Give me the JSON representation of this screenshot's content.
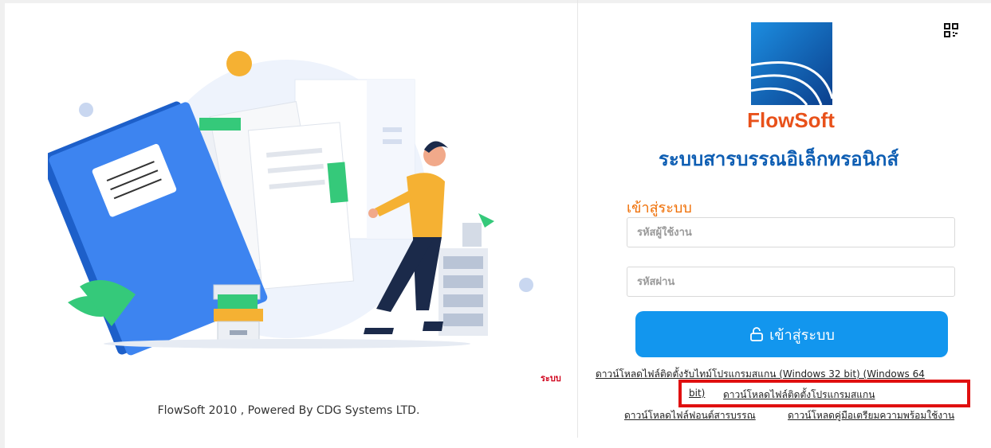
{
  "footer": {
    "copyright": "FlowSoft 2010 , Powered By CDG Systems LTD."
  },
  "logo": {
    "brand": "FlowSoft"
  },
  "header": {
    "system_title": "ระบบสารบรรณอิเล็กทรอนิกส์"
  },
  "login": {
    "heading": "เข้าสู่ระบบ",
    "username_placeholder": "รหัสผู้ใช้งาน",
    "password_placeholder": "รหัสผ่าน",
    "button_label": "เข้าสู่ระบบ"
  },
  "notice": {
    "red_word": "ระบบ"
  },
  "downloads": {
    "scanner_32_64": "ดาวน์โหลดไฟล์ติดตั้งรับไทม์โปรแกรมสแกน (Windows 32 bit) (Windows 64",
    "scanner_32_64_cont": "bit)",
    "scanner_installer": "ดาวน์โหลดไฟล์ติดตั้งโปรแกรมสแกน",
    "font_file": "ดาวน์โหลดไฟล์ฟอนต์สารบรรณ",
    "readiness_manual": "ดาวน์โหลดคู่มือเตรียมความพร้อมใช้งาน"
  },
  "colors": {
    "primary_button": "#1296ee",
    "title": "#0e5eb3",
    "heading": "#ef6c00",
    "highlight": "#e01010"
  }
}
